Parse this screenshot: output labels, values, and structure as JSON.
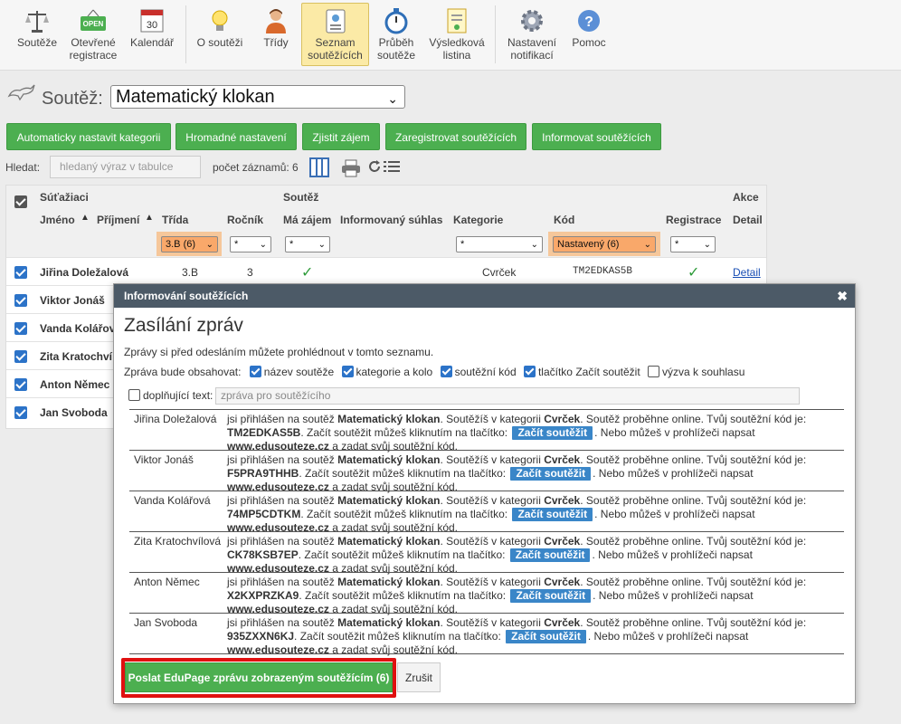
{
  "toolbar": {
    "items": [
      {
        "line1": "Soutěže",
        "line2": "",
        "icon": "scales-icon"
      },
      {
        "line1": "Otevřené",
        "line2": "registrace",
        "icon": "open-sign-icon",
        "badge": "OPEN"
      },
      {
        "line1": "Kalendář",
        "line2": "",
        "icon": "calendar-icon",
        "badge": "30"
      },
      {
        "line1": "O soutěži",
        "line2": "",
        "icon": "lightbulb-icon"
      },
      {
        "line1": "Třídy",
        "line2": "",
        "icon": "person-icon"
      },
      {
        "line1": "Seznam",
        "line2": "soutěžících",
        "icon": "id-card-icon"
      },
      {
        "line1": "Průběh",
        "line2": "soutěže",
        "icon": "stopwatch-icon"
      },
      {
        "line1": "Výsledková",
        "line2": "listina",
        "icon": "certificate-icon"
      },
      {
        "line1": "Nastavení",
        "line2": "notifikací",
        "icon": "gear-icon"
      },
      {
        "line1": "Pomoc",
        "line2": "",
        "icon": "help-icon"
      }
    ]
  },
  "contest": {
    "label": "Soutěž:",
    "selected": "Matematický klokan"
  },
  "actions": [
    "Automaticky nastavit kategorii",
    "Hromadné nastavení",
    "Zjistit zájem",
    "Zaregistrovat soutěžících",
    "Informovat soutěžících"
  ],
  "search": {
    "label": "Hledat:",
    "placeholder": "hledaný výraz v tabulce",
    "count_text": "počet záznamů: 6"
  },
  "grid": {
    "group1": "Súťažiaci",
    "group2": "Soutěž",
    "group3": "Akce",
    "columns": [
      "Jméno",
      "Příjmení",
      "Třída",
      "Ročník",
      "Má zájem",
      "Informovaný súhlas",
      "Kategorie",
      "Kód",
      "Registrace",
      "Detail"
    ],
    "filters": {
      "trida": "3.B (6)",
      "rocnik": "*",
      "zajem": "*",
      "kategorie": "*",
      "kod": "Nastavený (6)",
      "registrace": "*"
    },
    "first_row": {
      "name": "Jiřina Doležalová",
      "trida": "3.B",
      "rocnik": "3",
      "zajem": "✓",
      "kategorie": "Cvrček",
      "kod": "TM2EDKAS5B",
      "registrace": "✓",
      "detail": "Detail"
    },
    "rows": [
      "Viktor Jonáš",
      "Vanda Kolářov",
      "Zita Kratochví",
      "Anton Němec",
      "Jan Svoboda"
    ]
  },
  "modal": {
    "header": "Informování soutěžících",
    "close": "✖",
    "title": "Zasílání zpráv",
    "desc": "Zprávy si před odesláním můžete prohlédnout v tomto seznamu.",
    "contains_label": "Zpráva bude obsahovat:",
    "options": [
      {
        "label": "název soutěže",
        "checked": true
      },
      {
        "label": "kategorie a kolo",
        "checked": true
      },
      {
        "label": "soutěžní kód",
        "checked": true
      },
      {
        "label": "tlačítko Začít soutěžit",
        "checked": true
      },
      {
        "label": "výzva k souhlasu",
        "checked": false
      }
    ],
    "extra_label": "doplňující text:",
    "extra_placeholder": "zpráva pro soutěžícího",
    "msg": {
      "t1": "jsi přihlášen na soutěž ",
      "contest": "Matematický klokan",
      "t2": ". Soutěžíš v kategorii ",
      "category": "Cvrček",
      "t3": ". Soutěž proběhne online. Tvůj soutěžní kód je: ",
      "t4": ". Začít soutěžit můžeš kliknutím na tlačítko: ",
      "button": "Začít soutěžit",
      "t5": ". Nebo můžeš v prohlížeči napsat ",
      "site": "www.edusouteze.cz",
      "t6": " a zadat svůj soutěžní kód."
    },
    "messages": [
      {
        "name": "Jiřina Doležalová",
        "code": "TM2EDKAS5B"
      },
      {
        "name": "Viktor Jonáš",
        "code": "F5PRA9THHB"
      },
      {
        "name": "Vanda Kolářová",
        "code": "74MP5CDTKM"
      },
      {
        "name": "Zita Kratochvílová",
        "code": "CK78KSB7EP"
      },
      {
        "name": "Anton Němec",
        "code": "X2KXPRZKA9"
      },
      {
        "name": "Jan Svoboda",
        "code": "935ZXXN6KJ"
      }
    ],
    "send": "Poslat EduPage zprávu zobrazeným soutěžícím (6)",
    "cancel": "Zrušit"
  }
}
